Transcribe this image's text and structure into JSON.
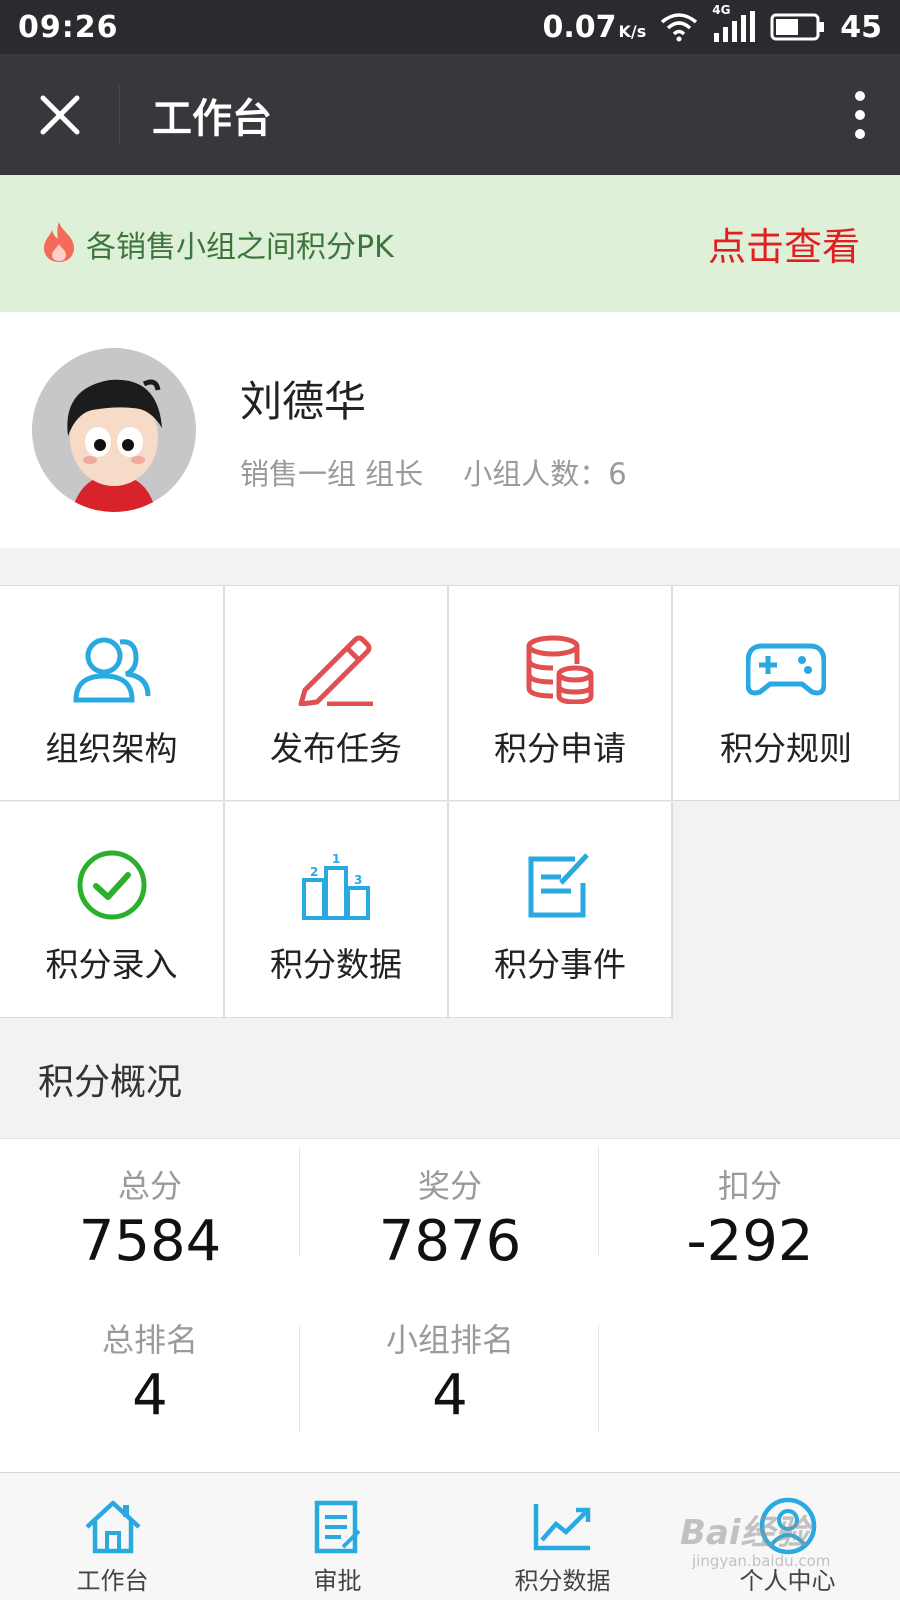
{
  "status_bar": {
    "time": "09:26",
    "speed": "0.07",
    "speed_unit": "K/s",
    "network": "4G",
    "battery": "45"
  },
  "title_bar": {
    "title": "工作台",
    "close_icon": "close-icon",
    "more_icon": "more-vertical-icon"
  },
  "banner": {
    "text": "各销售小组之间积分PK",
    "link": "点击查看",
    "icon": "fire-icon",
    "link_color": "#e02020",
    "bg_color": "#dff0d8"
  },
  "profile": {
    "name": "刘德华",
    "role": "销售一组 组长",
    "group_size": "小组人数：6"
  },
  "grid": [
    {
      "label": "组织架构",
      "icon": "people-icon",
      "color": "#29a9e0"
    },
    {
      "label": "发布任务",
      "icon": "pencil-icon",
      "color": "#e05050"
    },
    {
      "label": "积分申请",
      "icon": "coins-icon",
      "color": "#e05050"
    },
    {
      "label": "积分规则",
      "icon": "gamepad-icon",
      "color": "#29a9e0"
    },
    {
      "label": "积分录入",
      "icon": "check-circle-icon",
      "color": "#2bb02b"
    },
    {
      "label": "积分数据",
      "icon": "podium-icon",
      "color": "#29a9e0"
    },
    {
      "label": "积分事件",
      "icon": "edit-note-icon",
      "color": "#29a9e0"
    }
  ],
  "summary": {
    "title": "积分概况",
    "total_label": "总分",
    "total_value": "7584",
    "bonus_label": "奖分",
    "bonus_value": "7876",
    "deduct_label": "扣分",
    "deduct_value": "-292",
    "overall_rank_label": "总排名",
    "overall_rank_value": "4",
    "group_rank_label": "小组排名",
    "group_rank_value": "4"
  },
  "tabs": [
    {
      "label": "工作台",
      "icon": "home-icon"
    },
    {
      "label": "审批",
      "icon": "document-icon"
    },
    {
      "label": "积分数据",
      "icon": "chart-icon"
    },
    {
      "label": "个人中心",
      "icon": "user-icon"
    }
  ],
  "watermark": {
    "text": "Bai经验",
    "url": "jingyan.baidu.com"
  }
}
